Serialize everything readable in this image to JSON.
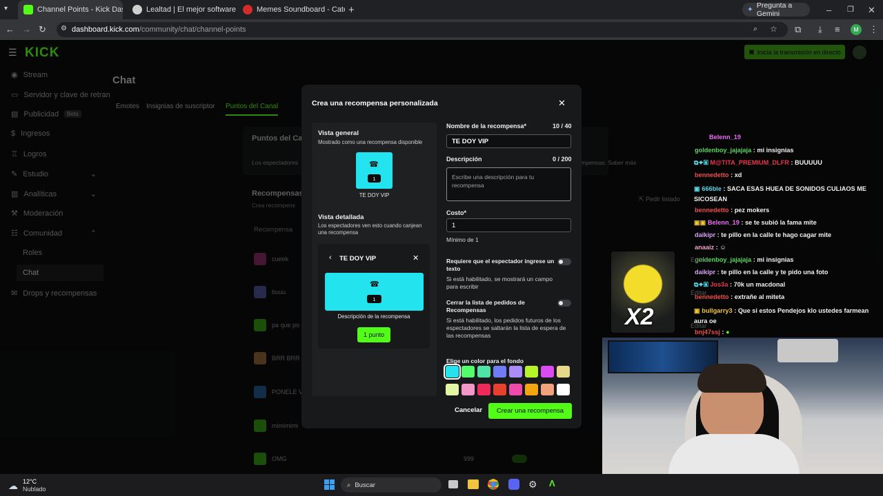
{
  "browser": {
    "tabs": [
      {
        "title": "Channel Points - Kick Dashboar",
        "fav_color": "#53fc18"
      },
      {
        "title": "Lealtad | El mejor software par",
        "fav_color": "#cfcfcf"
      },
      {
        "title": "Memes Soundboard - Categor",
        "fav_color": "#d62b2b"
      }
    ],
    "gemini_label": "Pregunta a Gemini",
    "url_host": "dashboard.kick.com",
    "url_path": "/community/chat/channel-points",
    "profile_initial": "M"
  },
  "app": {
    "logo": "KICK",
    "golive_label": "Inicia la transmisión en directo",
    "sidebar": [
      {
        "label": "Stream"
      },
      {
        "label": "Servidor y clave de retran"
      },
      {
        "label": "Publicidad",
        "badge": "Beta"
      },
      {
        "label": "Ingresos"
      },
      {
        "label": "Logros"
      },
      {
        "label": "Estudio"
      },
      {
        "label": "Analíticas"
      },
      {
        "label": "Moderación"
      },
      {
        "label": "Comunidad"
      },
      {
        "label": "Roles"
      },
      {
        "label": "Chat"
      },
      {
        "label": "Drops y recompensas"
      }
    ],
    "page_title": "Chat",
    "tabs": [
      "Emotes",
      "Insignias de suscriptor",
      "Puntos del Canal"
    ],
    "points_heading": "Puntos del Ca",
    "points_desc": "Los espectadores",
    "points_desc_right": "mpensas. Saber más",
    "rewards_heading": "Recompensas",
    "rewards_sub": "Crea recompens",
    "rewards_col": "Recompensa",
    "request_list": "Pedir listado",
    "rewards": [
      {
        "name": "cueek",
        "color": "#e0409a"
      },
      {
        "name": "buuu",
        "color": "#7b7ff5"
      },
      {
        "name": "pa que po",
        "color": "#53fc18"
      },
      {
        "name": "BRR BRR P",
        "color": "#f0a05a"
      },
      {
        "name": "PONELE V",
        "color": "#3a8ee6"
      },
      {
        "name": "mimimimi",
        "color": "#53fc18"
      },
      {
        "name": "OMG",
        "color": "#53fc18"
      }
    ],
    "omg_cost": "999",
    "edit_label": "Editar"
  },
  "modal": {
    "title": "Crea una recompensa personalizada",
    "overview_title": "Vista general",
    "overview_sub": "Mostrado como una recompensa disponible",
    "preview_count": "1",
    "preview_name": "TE DOY VIP",
    "detail_title": "Vista detallada",
    "detail_sub": "Los espectadores ven esto cuando canjean una recompensa",
    "detail_name": "TE DOY VIP",
    "detail_desc": "Descripción de la recompensa",
    "detail_button": "1 punto",
    "name_label": "Nombre de la recompensa*",
    "name_count": "10 / 40",
    "name_value": "TE DOY VIP",
    "desc_label": "Descripción",
    "desc_count": "0 / 200",
    "desc_placeholder": "Escribe una descripción para tu recompensa",
    "cost_label": "Costo*",
    "cost_value": "1",
    "cost_hint": "Mínimo de 1",
    "req_label": "Requiere que el espectador ingrese un texto",
    "req_sub": "Si está habilitado, se mostrará un campo para escribir",
    "close_label": "Cerrar la lista de pedidos de Recompensas",
    "close_sub": "Si está habilitado, los pedidos futuros de los espectadores se saltarán la lista de espera de las recompensas",
    "color_label": "Elige un color para el fondo",
    "colors": [
      "#22e3ee",
      "#53fc6b",
      "#4fe3a6",
      "#6f7cf5",
      "#a98cf7",
      "#b6f42a",
      "#d84cf2",
      "#e6d98a",
      "#e3f7a2",
      "#f297c8",
      "#ee2a5a",
      "#e8402f",
      "#ee4aa8",
      "#f3a40f",
      "#f2a27a",
      "#ffffff"
    ],
    "selected_color": "#22e3ee",
    "cancel_label": "Cancelar",
    "create_label": "Crear una recompensa"
  },
  "chat": [
    {
      "user": "Belenn_19",
      "msg": "",
      "color": "#e96bf0"
    },
    {
      "user": "goldenboy_jajajaja",
      "msg": "mi insignias",
      "color": "#59d65e"
    },
    {
      "user": "M@TITA_PREMIUM_DLFR",
      "msg": "BUUUUU",
      "color": "#e8354a"
    },
    {
      "user": "bennedetto",
      "msg": "xd",
      "color": "#ef4b4b"
    },
    {
      "user": "666ble",
      "msg": "SACA ESAS HUEA DE SONIDOS CULIAOS ME SICOSEAN",
      "color": "#59d6e8"
    },
    {
      "user": "bennedetto",
      "msg": "pez mokers",
      "color": "#ef4b4b"
    },
    {
      "user": "Belenn_19",
      "msg": "se te subió la fama mite",
      "color": "#e96bf0"
    },
    {
      "user": "daikipr",
      "msg": "te pillo en la calle te hago cagar mite",
      "color": "#d9a1f5"
    },
    {
      "user": "anaaiz",
      "msg": "",
      "color": "#f0a0c8"
    },
    {
      "user": "goldenboy_jajajaja",
      "msg": "mi insignias",
      "color": "#59d65e"
    },
    {
      "user": "daikipr",
      "msg": "te pillo en la calle y te pido una foto",
      "color": "#d9a1f5"
    },
    {
      "user": "Jos3a",
      "msg": "70k un macdonal",
      "color": "#e8354a"
    },
    {
      "user": "bennedetto",
      "msg": "extrañe al miteta",
      "color": "#ef4b4b"
    },
    {
      "user": "bullgarry3",
      "msg": "Que si estos Pendejos klo ustedes farmean aura oe",
      "color": "#f0c43a"
    },
    {
      "user": "bnj47ssj",
      "msg": "",
      "color": "#ef4b4b"
    }
  ],
  "sticker_text": "X2",
  "taskbar": {
    "temp": "12°C",
    "weather": "Nublado",
    "search": "Buscar"
  }
}
